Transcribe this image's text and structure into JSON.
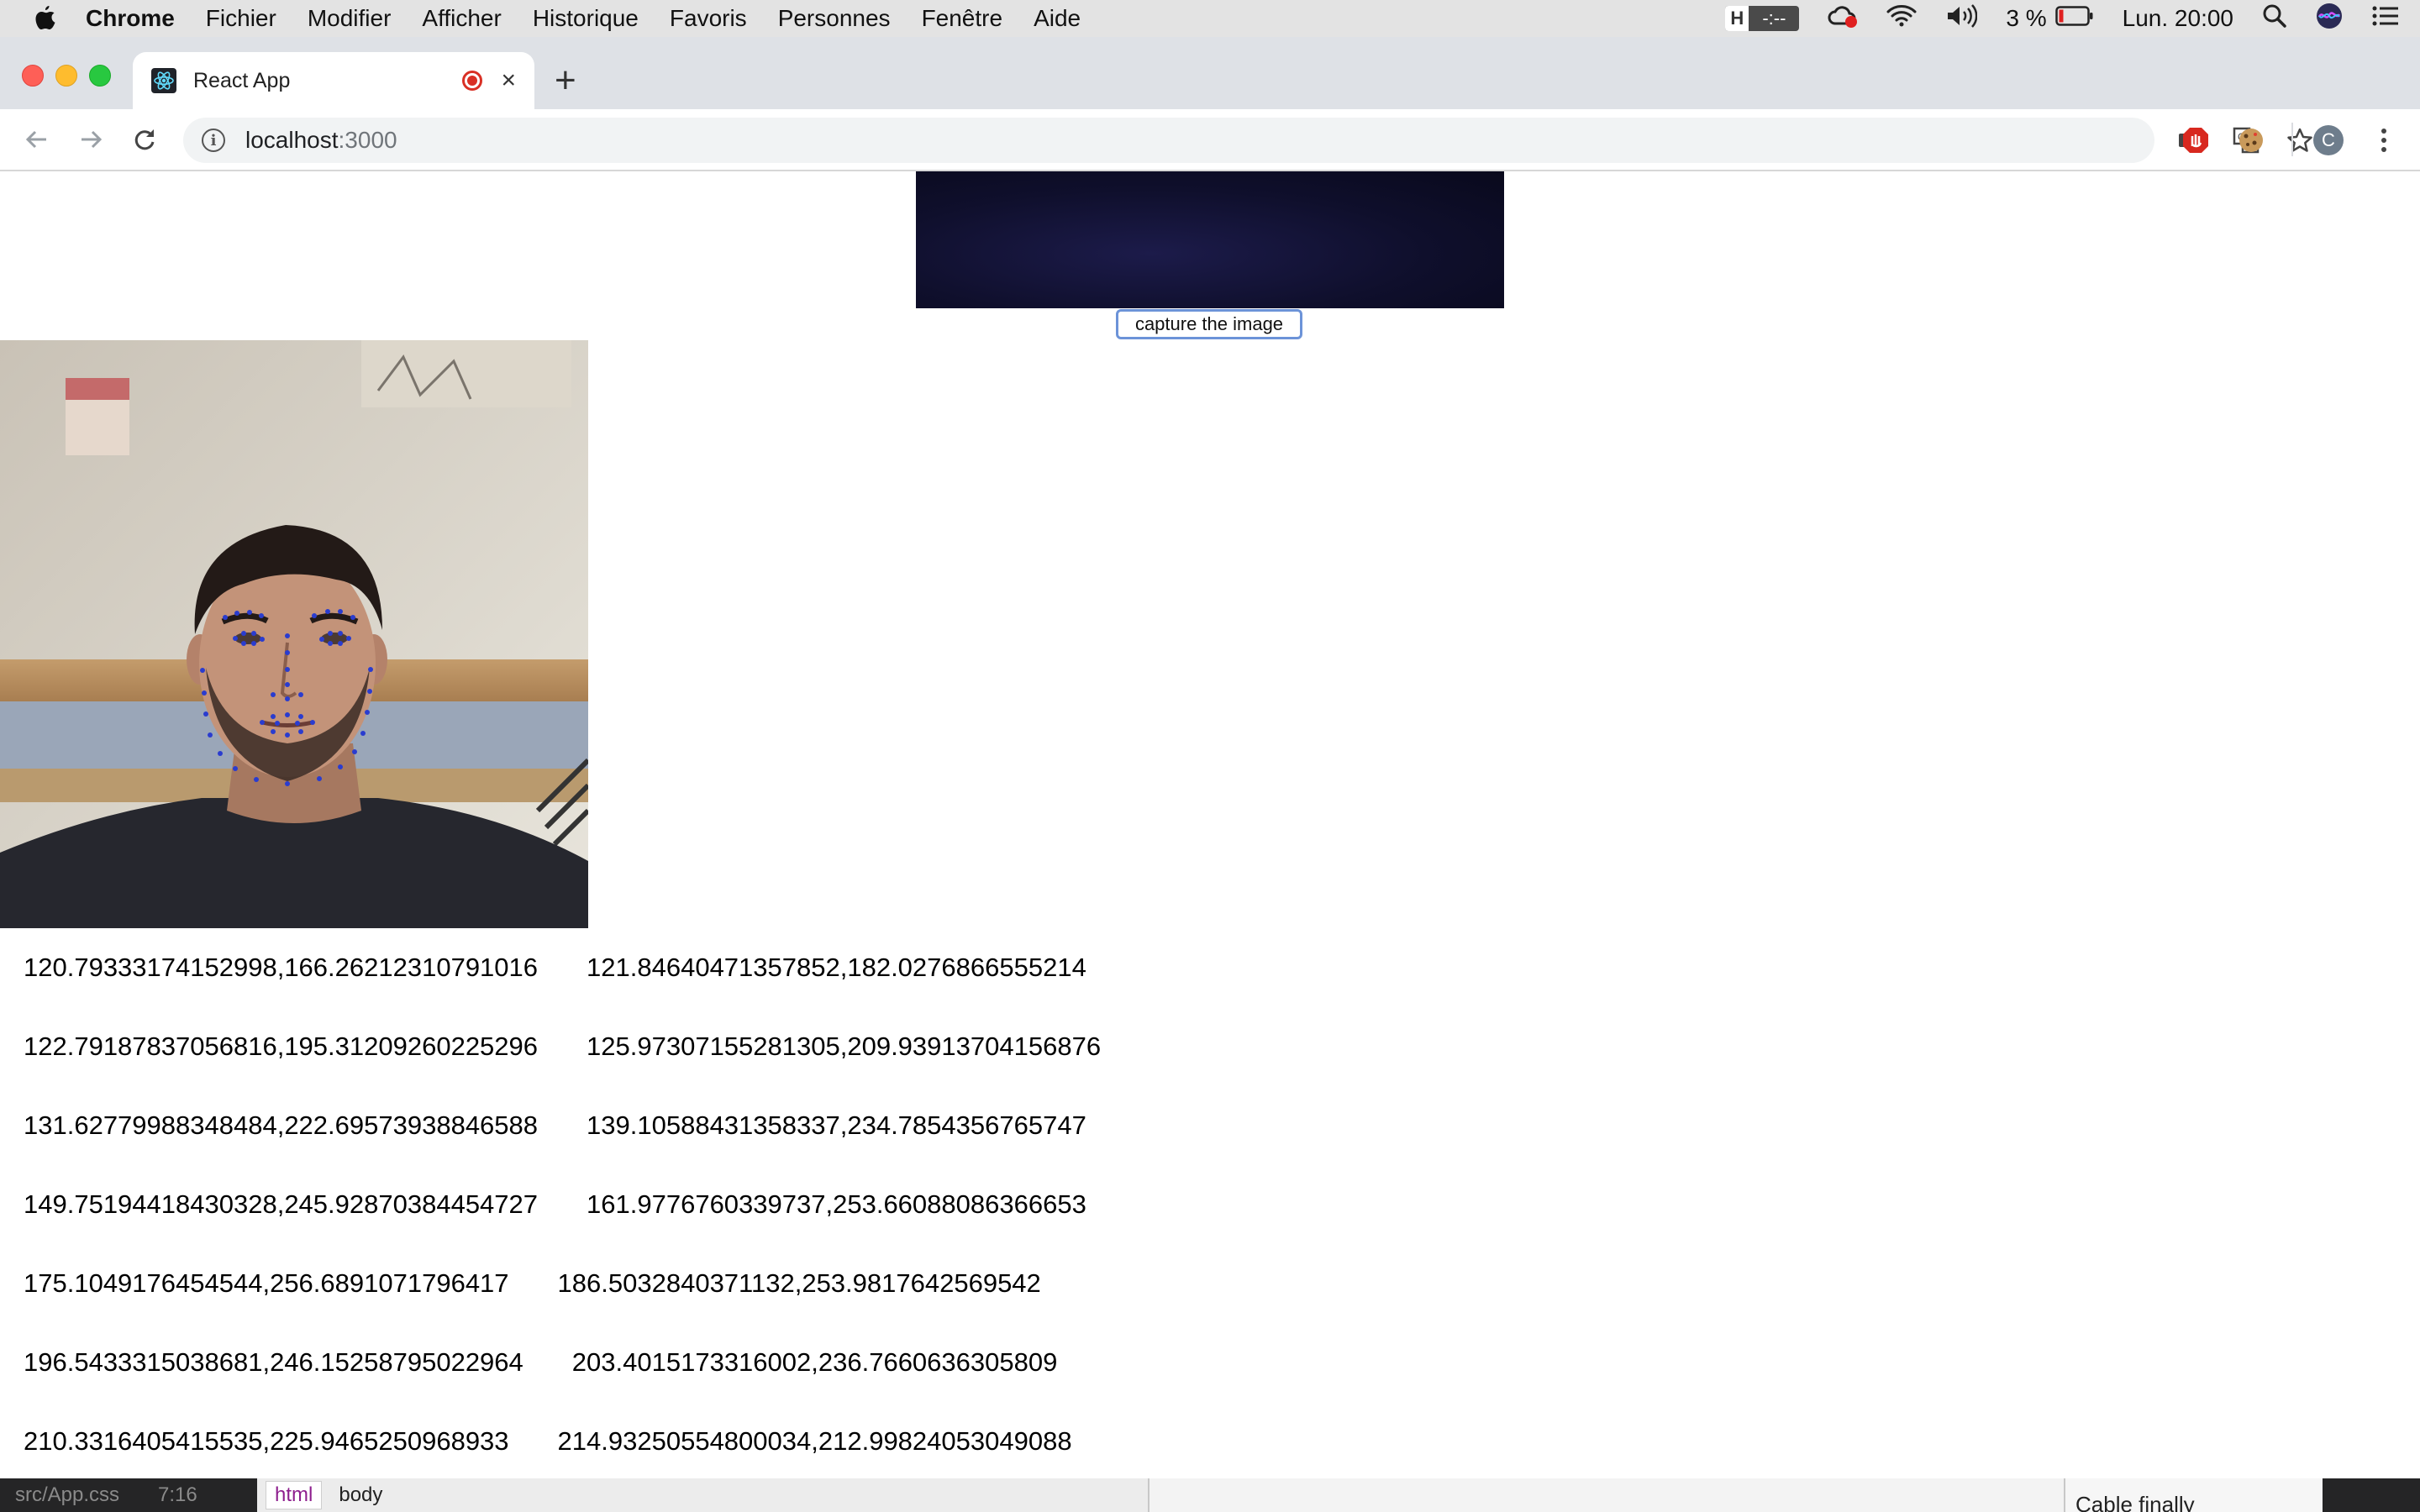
{
  "menubar": {
    "items": [
      "Chrome",
      "Fichier",
      "Modifier",
      "Afficher",
      "Historique",
      "Favoris",
      "Personnes",
      "Fenêtre",
      "Aide"
    ],
    "hbox_letter": "H",
    "hbox_time": "-:--",
    "battery": "3 %",
    "clock": "Lun. 20:00"
  },
  "tab": {
    "title": "React App",
    "close": "×"
  },
  "newtab": "+",
  "address": {
    "host": "localhost",
    "port": ":3000"
  },
  "profile_initial": "C",
  "page": {
    "capture_label": "capture the image",
    "coords": [
      [
        "120.79333174152998,166.26212310791016",
        "121.84640471357852,182.0276866555214"
      ],
      [
        "122.79187837056816,195.31209260225296",
        "125.97307155281305,209.93913704156876"
      ],
      [
        "131.62779988348484,222.69573938846588",
        "139.10588431358337,234.7854356765747"
      ],
      [
        "149.75194418430328,245.92870384454727",
        "161.9776760339737,253.66088086366653"
      ],
      [
        "175.1049176454544,256.6891071796417",
        "186.5032840371132,253.9817642569542"
      ],
      [
        "196.5433315038681,246.15258795022964",
        "203.4015173316002,236.7660636305809"
      ],
      [
        "210.3316405415535,225.9465250968933",
        "214.93250554800034,212.99824053049088"
      ]
    ]
  },
  "editor": {
    "file": "src/App.css",
    "position": "7:16",
    "crumbs": [
      "html",
      "body"
    ],
    "note": "Cable finally"
  }
}
